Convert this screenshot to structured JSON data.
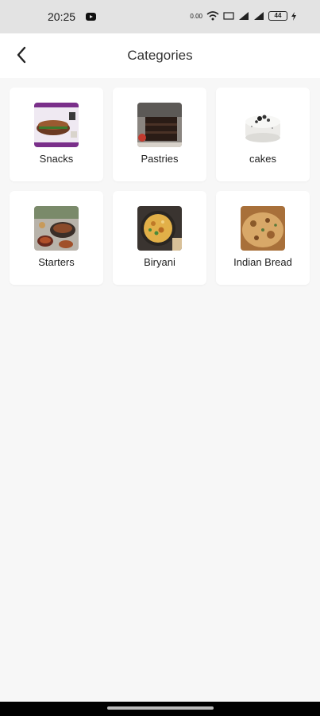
{
  "status_bar": {
    "time": "20:25",
    "speed": "0.00",
    "battery": "44"
  },
  "header": {
    "title": "Categories",
    "back_icon": "chevron-left-icon"
  },
  "categories": [
    {
      "label": "Snacks",
      "icon": "snacks-image"
    },
    {
      "label": "Pastries",
      "icon": "pastries-image"
    },
    {
      "label": "cakes",
      "icon": "cakes-image"
    },
    {
      "label": "Starters",
      "icon": "starters-image"
    },
    {
      "label": "Biryani",
      "icon": "biryani-image"
    },
    {
      "label": "Indian Bread",
      "icon": "indian-bread-image"
    }
  ],
  "colors": {
    "background": "#f7f7f7",
    "card": "#ffffff",
    "status_bar": "#e3e3e3"
  }
}
